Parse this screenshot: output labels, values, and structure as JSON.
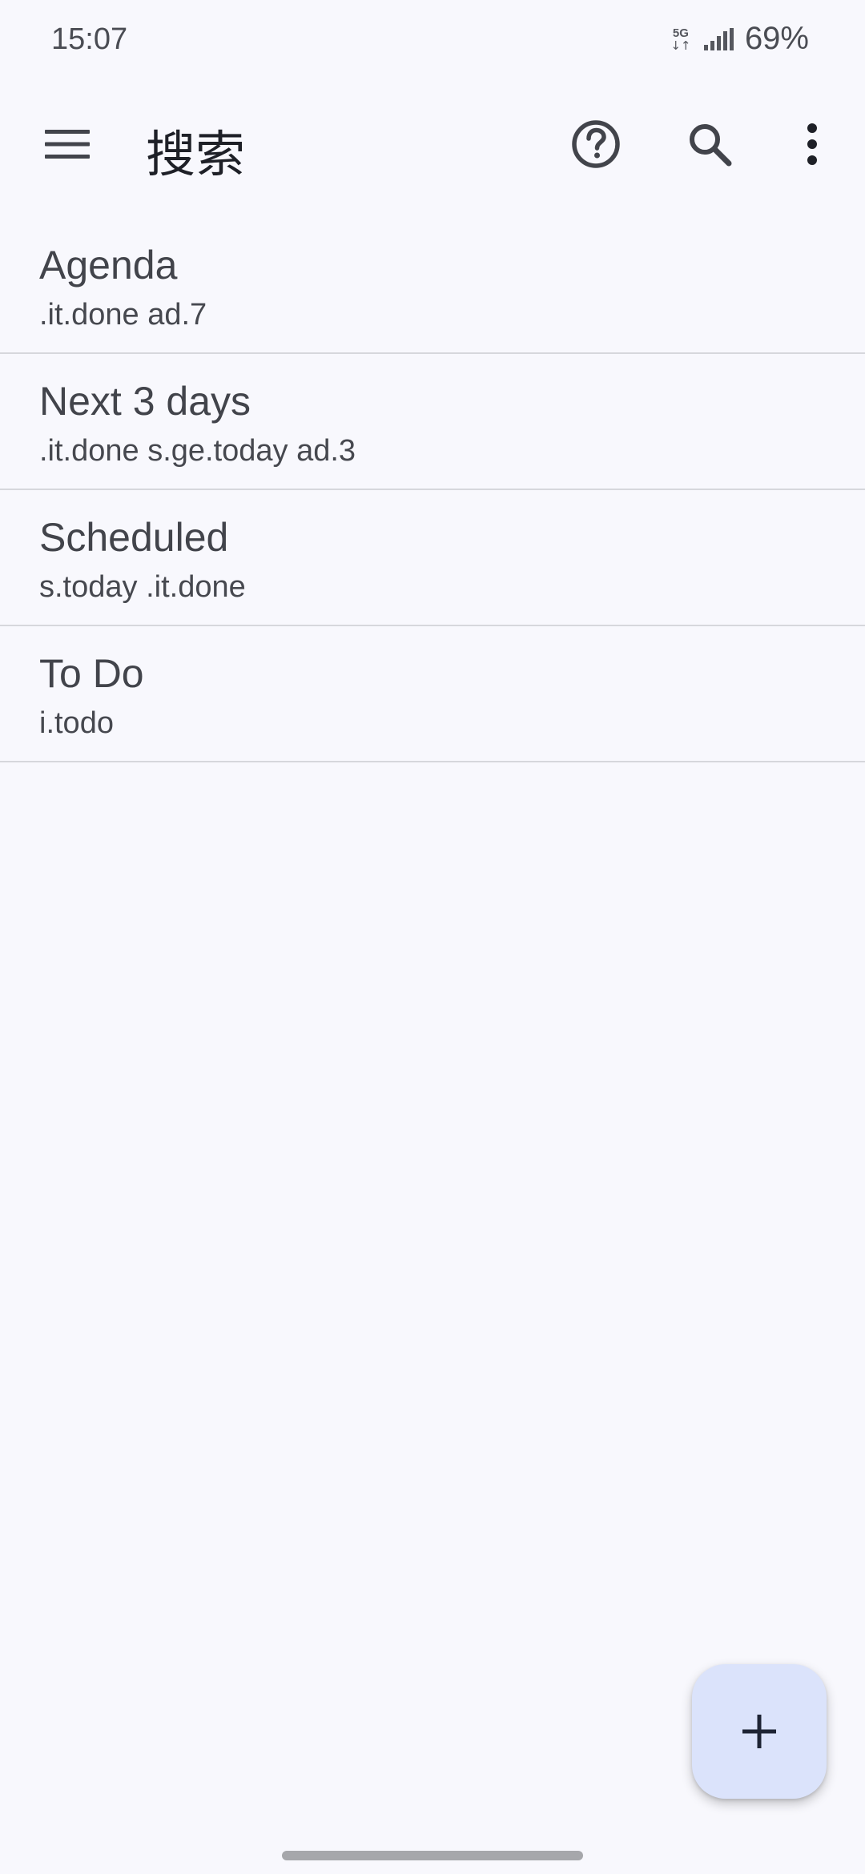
{
  "status_bar": {
    "time": "15:07",
    "network_label": "5G",
    "network_arrows": "↓↑",
    "battery": "69%"
  },
  "app_bar": {
    "title": "搜索",
    "icons": [
      "menu-icon",
      "help-icon",
      "search-icon",
      "more-vert-icon"
    ]
  },
  "searches": [
    {
      "title": "Agenda",
      "query": ".it.done ad.7"
    },
    {
      "title": "Next 3 days",
      "query": ".it.done s.ge.today ad.3"
    },
    {
      "title": "Scheduled",
      "query": "s.today .it.done"
    },
    {
      "title": "To Do",
      "query": "i.todo"
    }
  ],
  "fab": {
    "icon": "add-icon"
  },
  "colors": {
    "background": "#f8f8fd",
    "fab_background": "#dbe3fb",
    "divider": "#d6d7dc"
  }
}
